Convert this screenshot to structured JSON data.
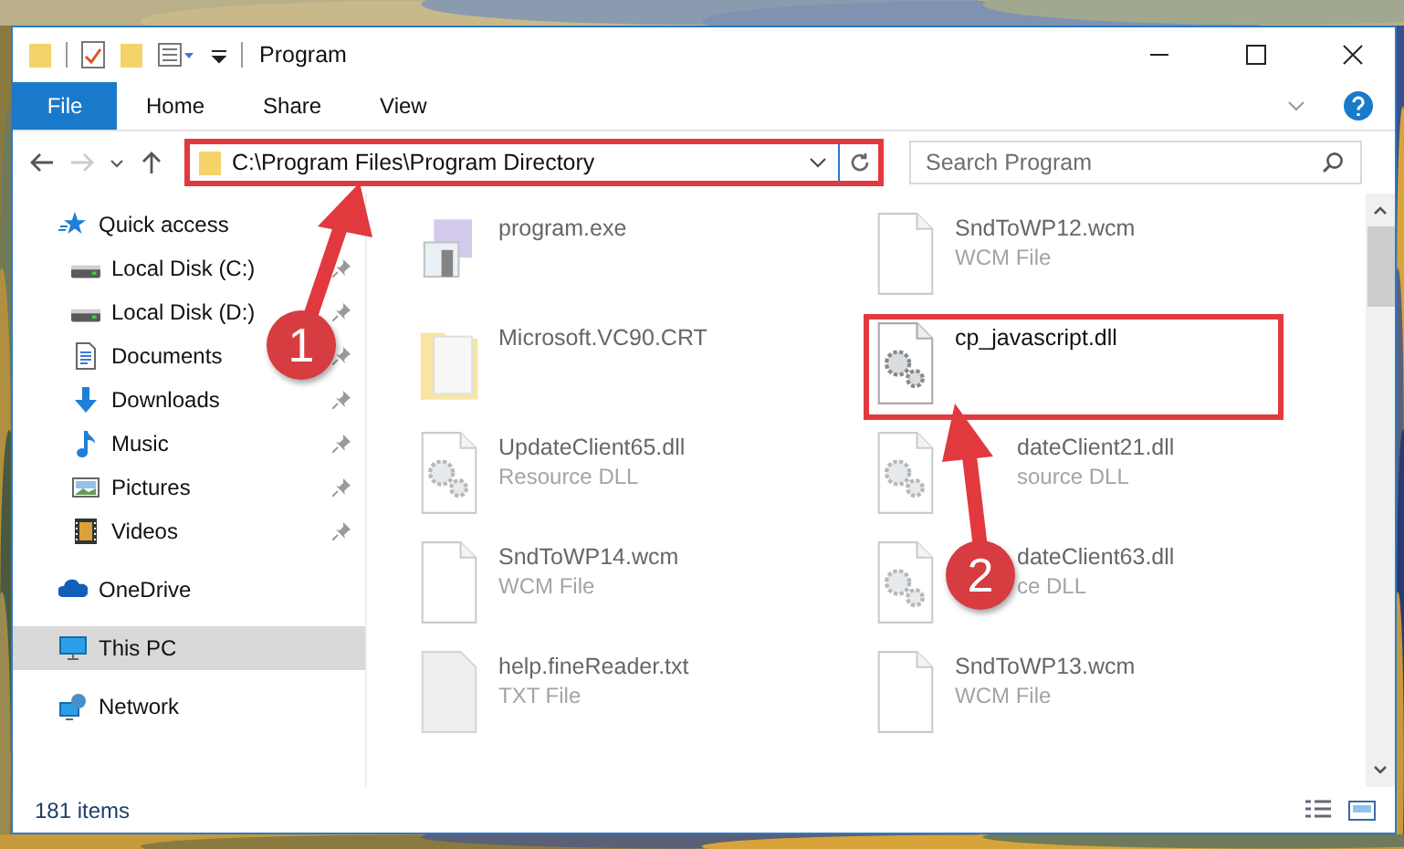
{
  "window": {
    "title": "Program"
  },
  "ribbon": {
    "tabs": [
      {
        "label": "File",
        "kind": "file",
        "selected": false
      },
      {
        "label": "Home",
        "kind": "tab",
        "selected": false
      },
      {
        "label": "Share",
        "kind": "tab",
        "selected": false
      },
      {
        "label": "View",
        "kind": "tab",
        "selected": false
      }
    ]
  },
  "address_bar": {
    "path": "C:\\Program Files\\Program Directory",
    "highlighted": true
  },
  "search": {
    "placeholder": "Search Program"
  },
  "navigation": [
    {
      "label": "Quick access",
      "kind": "star",
      "selected": false,
      "children": [
        {
          "label": "Local Disk (C:)",
          "kind": "drive",
          "pinned": true,
          "selected": false
        },
        {
          "label": "Local Disk (D:)",
          "kind": "drive",
          "pinned": true,
          "selected": false
        },
        {
          "label": "Documents",
          "kind": "document",
          "pinned": true,
          "selected": false
        },
        {
          "label": "Downloads",
          "kind": "download",
          "pinned": true,
          "selected": false
        },
        {
          "label": "Music",
          "kind": "music",
          "pinned": true,
          "selected": false
        },
        {
          "label": "Pictures",
          "kind": "pictures",
          "pinned": true,
          "selected": false
        },
        {
          "label": "Videos",
          "kind": "videos",
          "pinned": true,
          "selected": false
        }
      ]
    },
    {
      "label": "OneDrive",
      "kind": "cloud",
      "selected": false
    },
    {
      "label": "This PC",
      "kind": "computer",
      "selected": true
    },
    {
      "label": "Network",
      "kind": "network",
      "selected": false
    }
  ],
  "files": [
    {
      "name": "program.exe",
      "kind": "exe",
      "blurred": true
    },
    {
      "name": "SndToWP12.wcm",
      "type": "WCM File",
      "kind": "blank",
      "blurred": true
    },
    {
      "name": "Microsoft.VC90.CRT",
      "kind": "folder",
      "blurred": true
    },
    {
      "name": "cp_javascript.dll",
      "kind": "dll",
      "blurred": false,
      "highlighted": true
    },
    {
      "name": "UpdateClient65.dll",
      "type": "Resource DLL",
      "kind": "dll",
      "blurred": true
    },
    {
      "name": "dateClient21.dll",
      "type": "source DLL",
      "kind": "dll",
      "blurred": true,
      "covered": true
    },
    {
      "name": "SndToWP14.wcm",
      "type": "WCM File",
      "kind": "blank",
      "blurred": true
    },
    {
      "name": "dateClient63.dll",
      "type": "ce DLL",
      "kind": "dll",
      "blurred": true,
      "covered": true
    },
    {
      "name": "help.fineReader.txt",
      "type": "TXT File",
      "kind": "text",
      "blurred": true
    },
    {
      "name": "SndToWP13.wcm",
      "type": "WCM File",
      "kind": "blank",
      "blurred": true
    }
  ],
  "annotations": [
    {
      "number": "1"
    },
    {
      "number": "2"
    }
  ],
  "status_bar": {
    "item_count": "181 items"
  }
}
